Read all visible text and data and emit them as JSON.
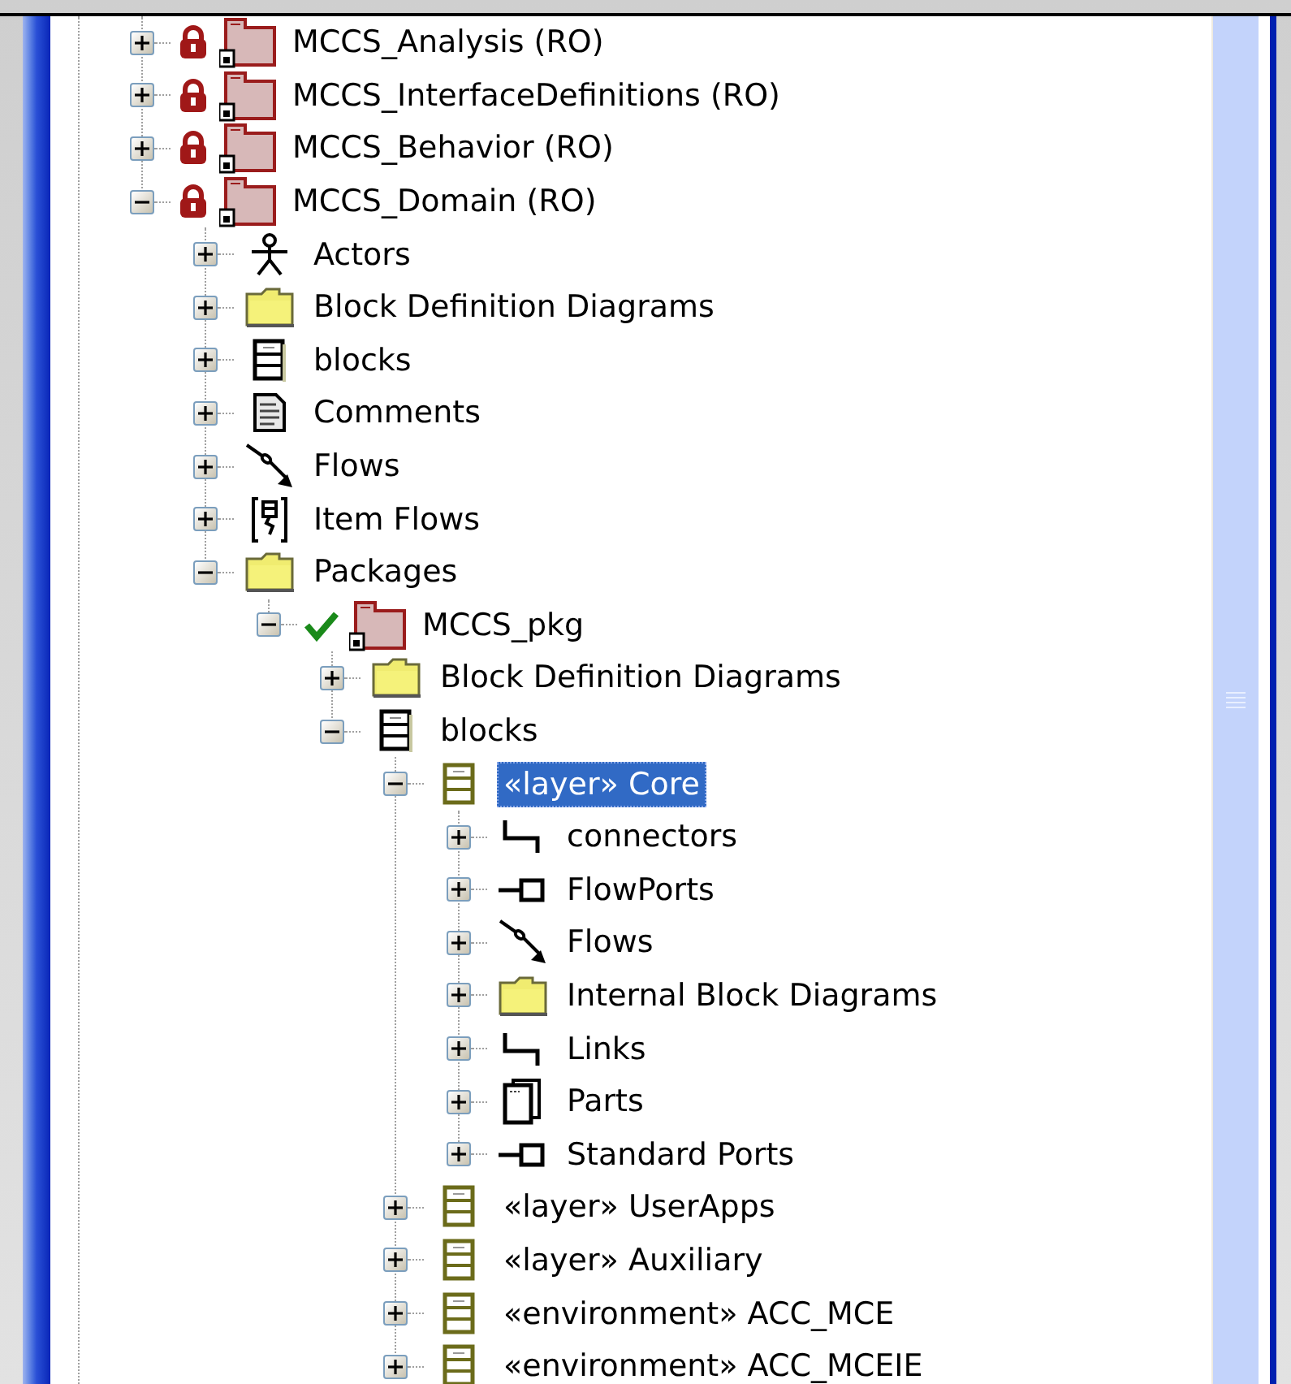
{
  "tree": [
    {
      "label": "MCCS_Analysis (RO)",
      "kind": "package",
      "locked": true,
      "checked_out": false,
      "expanded": false,
      "selected": false
    },
    {
      "label": "MCCS_InterfaceDefinitions (RO)",
      "kind": "package",
      "locked": true,
      "checked_out": false,
      "expanded": false,
      "selected": false
    },
    {
      "label": "MCCS_Behavior (RO)",
      "kind": "package",
      "locked": true,
      "checked_out": false,
      "expanded": false,
      "selected": false
    },
    {
      "label": "MCCS_Domain (RO)",
      "kind": "package",
      "locked": true,
      "checked_out": false,
      "expanded": true,
      "selected": false,
      "children": [
        {
          "label": "Actors",
          "kind": "actors",
          "expanded": false,
          "selected": false
        },
        {
          "label": "Block Definition Diagrams",
          "kind": "folder",
          "expanded": false,
          "selected": false
        },
        {
          "label": "blocks",
          "kind": "blocks",
          "expanded": false,
          "selected": false
        },
        {
          "label": "Comments",
          "kind": "comments",
          "expanded": false,
          "selected": false
        },
        {
          "label": "Flows",
          "kind": "flows",
          "expanded": false,
          "selected": false
        },
        {
          "label": "Item Flows",
          "kind": "item_flows",
          "expanded": false,
          "selected": false
        },
        {
          "label": "Packages",
          "kind": "folder",
          "expanded": true,
          "selected": false,
          "children": [
            {
              "label": "MCCS_pkg",
              "kind": "package",
              "locked": false,
              "checked_out": true,
              "expanded": true,
              "selected": false,
              "children": [
                {
                  "label": "Block Definition Diagrams",
                  "kind": "folder",
                  "expanded": false,
                  "selected": false
                },
                {
                  "label": "blocks",
                  "kind": "blocks",
                  "expanded": true,
                  "selected": false,
                  "children": [
                    {
                      "label": "«layer» Core",
                      "kind": "block",
                      "expanded": true,
                      "selected": true,
                      "children": [
                        {
                          "label": "connectors",
                          "kind": "connectors",
                          "expanded": false,
                          "selected": false
                        },
                        {
                          "label": "FlowPorts",
                          "kind": "ports",
                          "expanded": false,
                          "selected": false
                        },
                        {
                          "label": "Flows",
                          "kind": "flows",
                          "expanded": false,
                          "selected": false
                        },
                        {
                          "label": "Internal Block Diagrams",
                          "kind": "folder",
                          "expanded": false,
                          "selected": false
                        },
                        {
                          "label": "Links",
                          "kind": "connectors",
                          "expanded": false,
                          "selected": false
                        },
                        {
                          "label": "Parts",
                          "kind": "parts",
                          "expanded": false,
                          "selected": false
                        },
                        {
                          "label": "Standard Ports",
                          "kind": "ports",
                          "expanded": false,
                          "selected": false
                        }
                      ]
                    },
                    {
                      "label": "«layer» UserApps",
                      "kind": "block",
                      "expanded": false,
                      "selected": false
                    },
                    {
                      "label": "«layer» Auxiliary",
                      "kind": "block",
                      "expanded": false,
                      "selected": false
                    },
                    {
                      "label": "«environment» ACC_MCE",
                      "kind": "block",
                      "expanded": false,
                      "selected": false
                    },
                    {
                      "label": "«environment» ACC_MCEIE",
                      "kind": "block",
                      "expanded": false,
                      "selected": false
                    }
                  ]
                }
              ]
            }
          ]
        }
      ]
    }
  ]
}
